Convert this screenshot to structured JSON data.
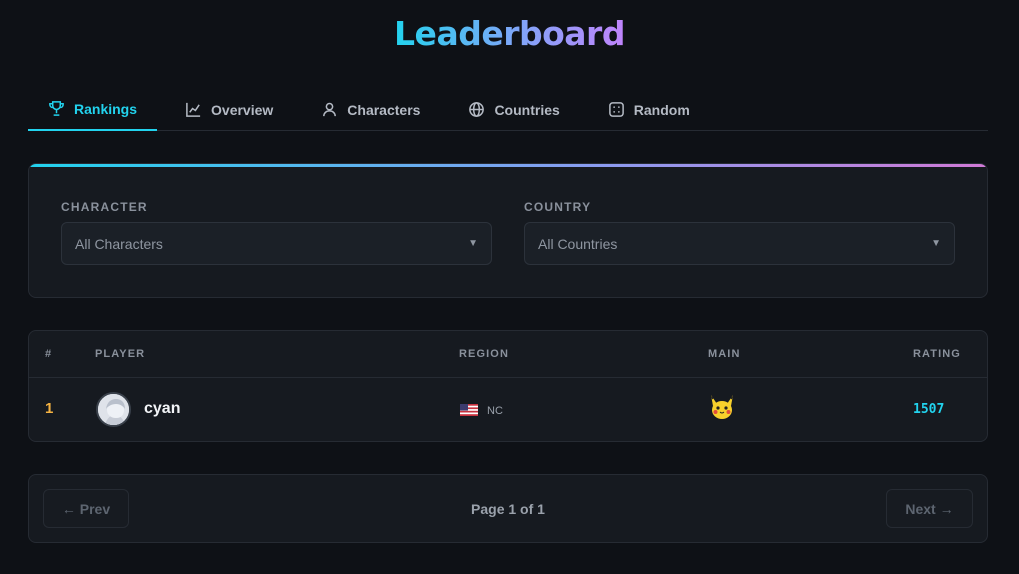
{
  "header": {
    "title": "Leaderboard"
  },
  "tabs": [
    {
      "label": "Rankings",
      "icon": "trophy-icon",
      "active": true
    },
    {
      "label": "Overview",
      "icon": "line-chart-icon",
      "active": false
    },
    {
      "label": "Characters",
      "icon": "user-icon",
      "active": false
    },
    {
      "label": "Countries",
      "icon": "globe-icon",
      "active": false
    },
    {
      "label": "Random",
      "icon": "dice-icon",
      "active": false
    }
  ],
  "filters": {
    "character": {
      "label": "CHARACTER",
      "value": "All Characters"
    },
    "country": {
      "label": "COUNTRY",
      "value": "All Countries"
    }
  },
  "table": {
    "columns": [
      "#",
      "PLAYER",
      "REGION",
      "MAIN",
      "RATING"
    ],
    "rows": [
      {
        "rank": "1",
        "player": "cyan",
        "flag": "us-flag-icon",
        "region": "NC",
        "main": "pikachu-icon",
        "rating": "1507"
      }
    ]
  },
  "pagination": {
    "prev_label": "← Prev",
    "next_label": "Next →",
    "info": "Page 1 of 1"
  },
  "colors": {
    "accent": "#22d3ee",
    "gradient_end": "#c084fc",
    "rank_gold": "#f5b342",
    "background": "#0e1116"
  }
}
